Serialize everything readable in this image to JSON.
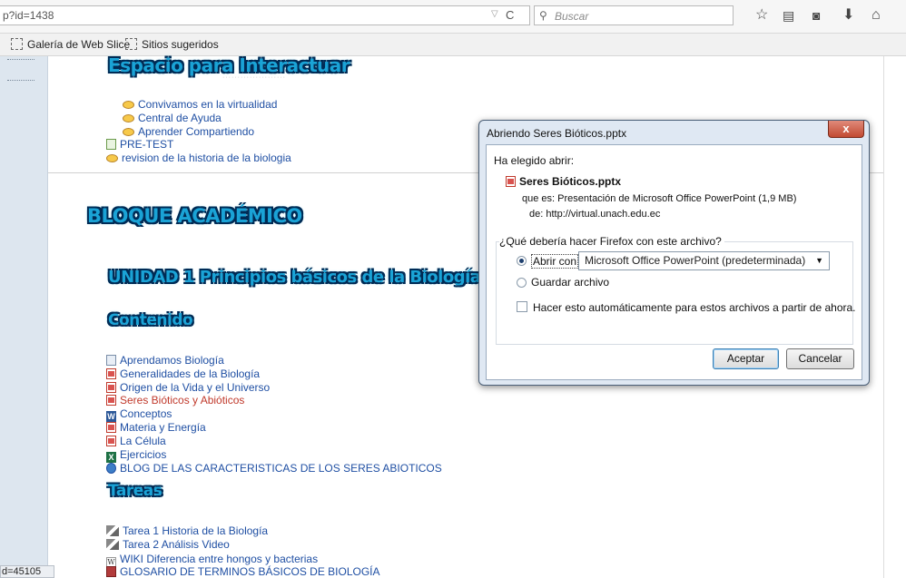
{
  "browser": {
    "url": "p?id=1438",
    "search_placeholder": "Buscar",
    "bookmarks": [
      "Galería de Web Slice",
      "Sitios sugeridos"
    ],
    "status_text": "d=45105"
  },
  "page": {
    "section1_heading": "Espacio para Interactuar",
    "section1_items": [
      {
        "icon": "forum-icon",
        "label": "Convivamos en la virtualidad"
      },
      {
        "icon": "forum-icon",
        "label": "Central de Ayuda"
      },
      {
        "icon": "forum-icon",
        "label": "Aprender Compartiendo"
      },
      {
        "icon": "quiz-icon",
        "label": "PRE-TEST"
      },
      {
        "icon": "chat-icon",
        "label": "revision de la historia de la biologia"
      }
    ],
    "section2_heading": "BLOQUE ACADÉMICO",
    "unit_heading": "UNIDAD 1  Principios básicos de la Biología",
    "content_heading": "Contenido",
    "content_items": [
      {
        "icon": "document-icon",
        "label": "Aprendamos Biología"
      },
      {
        "icon": "powerpoint-icon",
        "label": "Generalidades de la Biología"
      },
      {
        "icon": "powerpoint-icon",
        "label": "Origen de la Vida y el Universo"
      },
      {
        "icon": "powerpoint-icon",
        "label": "Seres Bióticos y Abióticos"
      },
      {
        "icon": "word-icon",
        "label": "Conceptos"
      },
      {
        "icon": "powerpoint-icon",
        "label": "Materia y Energía"
      },
      {
        "icon": "powerpoint-icon",
        "label": "La Célula"
      },
      {
        "icon": "excel-icon",
        "label": "Ejercicios"
      },
      {
        "icon": "blog-icon",
        "label": "BLOG DE LAS CARACTERISTICAS DE LOS SERES ABIOTICOS"
      }
    ],
    "tasks_heading": "Tareas",
    "task_items": [
      {
        "icon": "assignment-icon",
        "label": "Tarea 1 Historia de la Biología"
      },
      {
        "icon": "assignment-icon",
        "label": "Tarea 2 Análisis Video"
      },
      {
        "icon": "wiki-icon",
        "label": "WIKI Diferencia entre hongos y bacterias"
      },
      {
        "icon": "glossary-icon",
        "label": "GLOSARIO DE TERMINOS BÁSICOS DE BIOLOGÍA"
      }
    ]
  },
  "dialog": {
    "title": "Abriendo Seres Bióticos.pptx",
    "close_label": "x",
    "intro": "Ha elegido abrir:",
    "filename": "Seres Bióticos.pptx",
    "type_label": "que es:",
    "type_value": "Presentación de Microsoft Office PowerPoint (1,9 MB)",
    "from_label": "de:",
    "from_value": "http://virtual.unach.edu.ec",
    "question": "¿Qué debería hacer Firefox con este archivo?",
    "open_with_label": "Abrir con",
    "open_with_selected": "Microsoft Office PowerPoint (predeterminada)",
    "save_label": "Guardar archivo",
    "auto_label": "Hacer esto automáticamente para estos archivos a partir de ahora.",
    "accept_label": "Aceptar",
    "cancel_label": "Cancelar",
    "open_with_checked": true,
    "auto_checked": false
  }
}
